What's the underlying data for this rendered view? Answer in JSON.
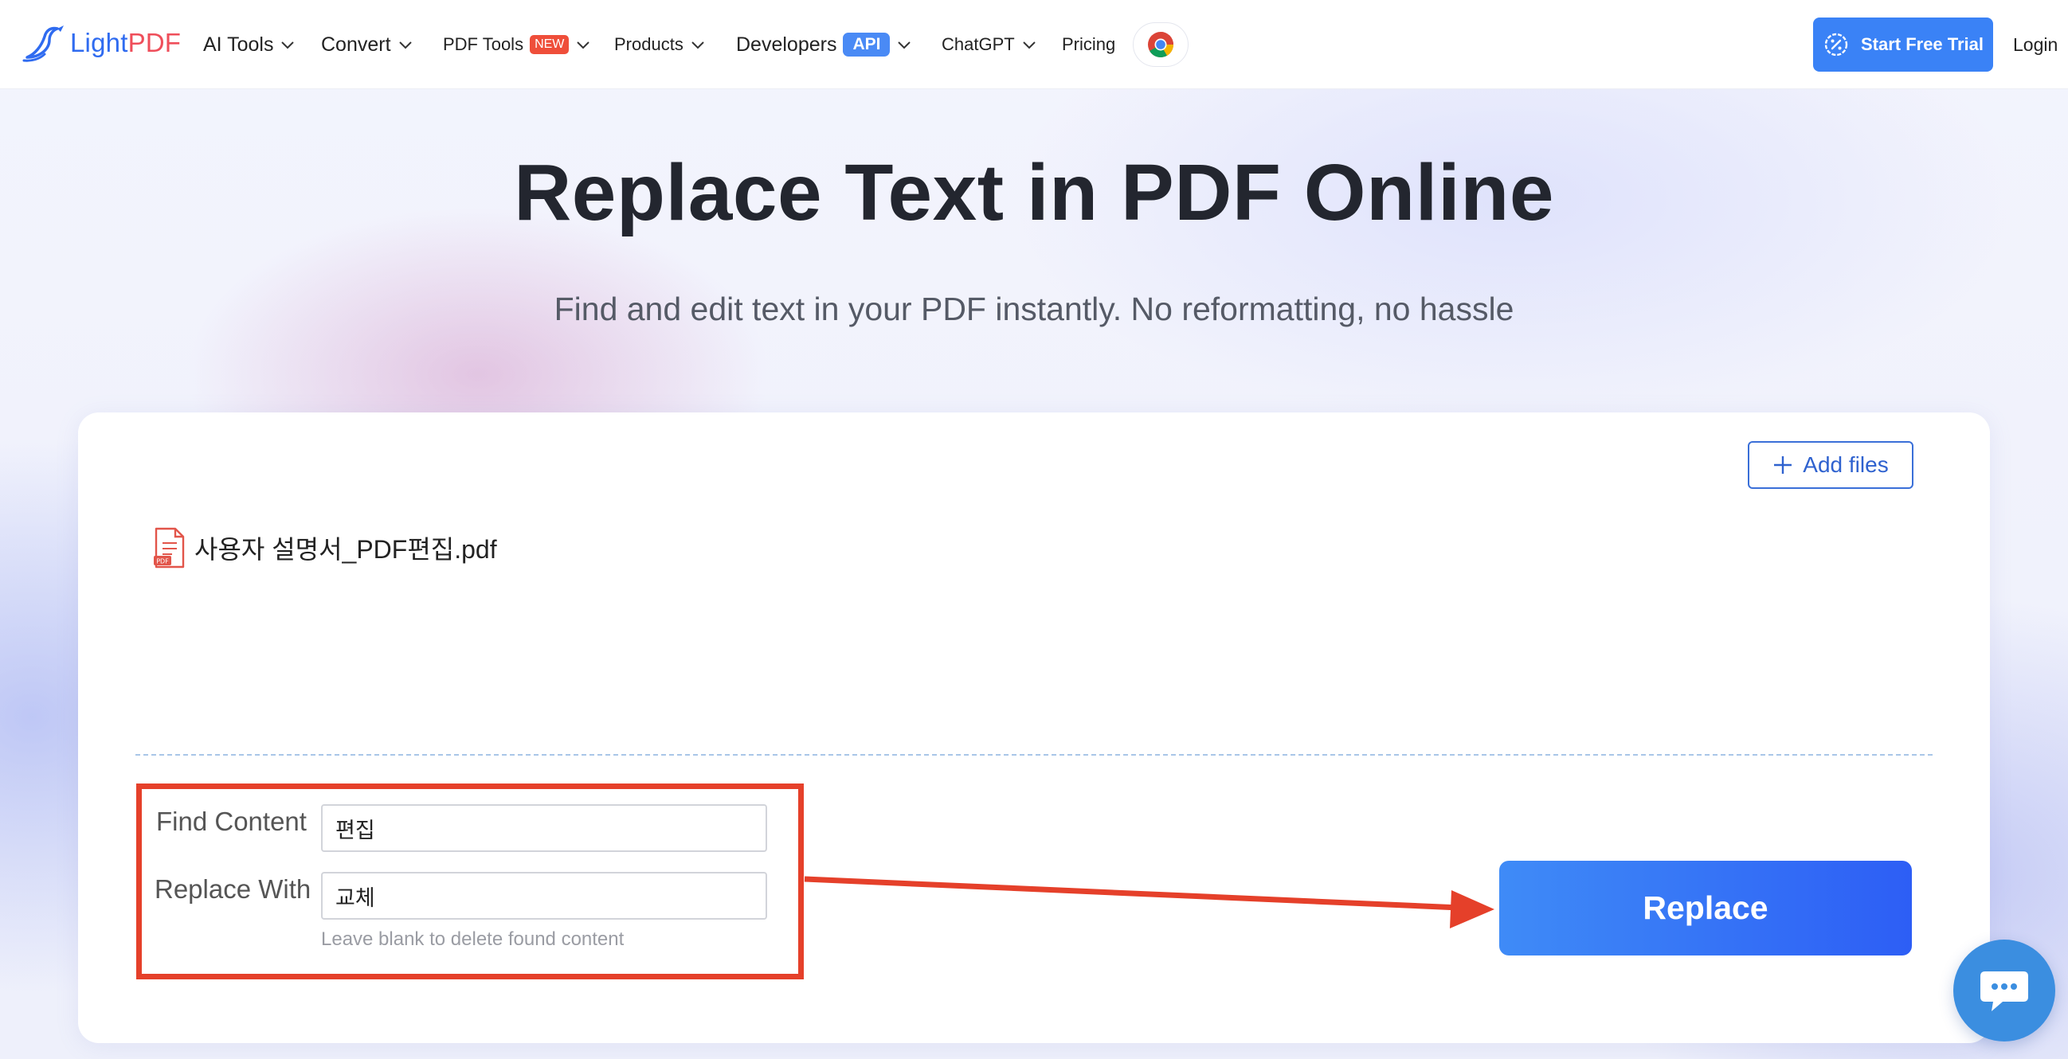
{
  "header": {
    "logo": {
      "light": "Light",
      "pdf": "PDF"
    },
    "nav": [
      {
        "label": "AI Tools"
      },
      {
        "label": "Convert"
      },
      {
        "label": "PDF Tools",
        "badge": "NEW"
      },
      {
        "label": "Products"
      },
      {
        "label": "Developers",
        "badge": "API"
      },
      {
        "label": "ChatGPT"
      },
      {
        "label": "Pricing"
      }
    ],
    "trial_label": "Start Free Trial",
    "login_label": "Login"
  },
  "hero": {
    "title": "Replace Text in PDF Online",
    "subtitle": "Find and edit text in your PDF instantly. No reformatting, no hassle"
  },
  "card": {
    "add_files_label": "Add files",
    "file_name": "사용자 설명서_PDF편집.pdf",
    "find_label": "Find Content",
    "find_value": "편집",
    "replace_label": "Replace With",
    "replace_value": "교체",
    "hint": "Leave blank to delete found content",
    "replace_button": "Replace"
  },
  "icons": {
    "logo": "logo-bird-icon",
    "chevron": "chevron-down-icon",
    "chrome": "chrome-icon",
    "trial": "discount-icon",
    "add": "plus-icon",
    "file": "pdf-file-icon",
    "chat": "chat-icon"
  },
  "colors": {
    "brand_blue": "#3a82f6",
    "brand_red": "#ef4e5a",
    "annotation_red": "#e5402a"
  }
}
